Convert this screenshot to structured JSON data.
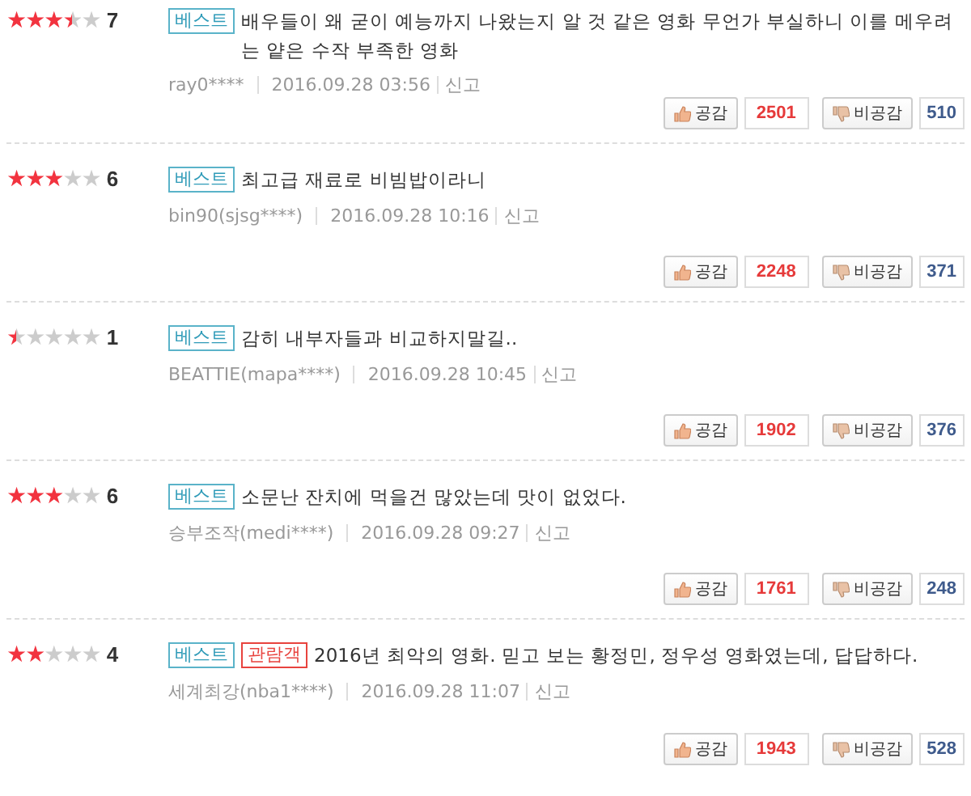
{
  "reviews": [
    {
      "stars": 3.5,
      "score": "7",
      "badges": [
        {
          "kind": "best",
          "label": "베스트"
        }
      ],
      "text": "배우들이 왜 굳이 예능까지 나왔는지 알 것 같은 영화 무언가 부실하니 이를 메우려는 얕은 수작 부족한 영화",
      "author": "ray0****",
      "date": "2016.09.28 03:56",
      "report": "신고",
      "like_label": "공감",
      "likes": "2501",
      "dislike_label": "비공감",
      "dislikes": "510"
    },
    {
      "stars": 3,
      "score": "6",
      "badges": [
        {
          "kind": "best",
          "label": "베스트"
        }
      ],
      "text": "최고급 재료로 비빔밥이라니",
      "author": "bin90(sjsg****)",
      "date": "2016.09.28 10:16",
      "report": "신고",
      "like_label": "공감",
      "likes": "2248",
      "dislike_label": "비공감",
      "dislikes": "371"
    },
    {
      "stars": 0.5,
      "score": "1",
      "badges": [
        {
          "kind": "best",
          "label": "베스트"
        }
      ],
      "text": "감히 내부자들과 비교하지말길..",
      "author": "BEATTIE(mapa****)",
      "date": "2016.09.28 10:45",
      "report": "신고",
      "like_label": "공감",
      "likes": "1902",
      "dislike_label": "비공감",
      "dislikes": "376"
    },
    {
      "stars": 3,
      "score": "6",
      "badges": [
        {
          "kind": "best",
          "label": "베스트"
        }
      ],
      "text": "소문난 잔치에 먹을건 많았는데 맛이 없었다.",
      "author": "승부조작(medi****)",
      "date": "2016.09.28 09:27",
      "report": "신고",
      "like_label": "공감",
      "likes": "1761",
      "dislike_label": "비공감",
      "dislikes": "248"
    },
    {
      "stars": 2,
      "score": "4",
      "badges": [
        {
          "kind": "best",
          "label": "베스트"
        },
        {
          "kind": "viewer",
          "label": "관람객"
        }
      ],
      "text": "2016년 최악의 영화. 믿고 보는 황정민, 정우성 영화였는데, 답답하다.",
      "author": "세계최강(nba1****)",
      "date": "2016.09.28 11:07",
      "report": "신고",
      "like_label": "공감",
      "likes": "1943",
      "dislike_label": "비공감",
      "dislikes": "528"
    }
  ]
}
